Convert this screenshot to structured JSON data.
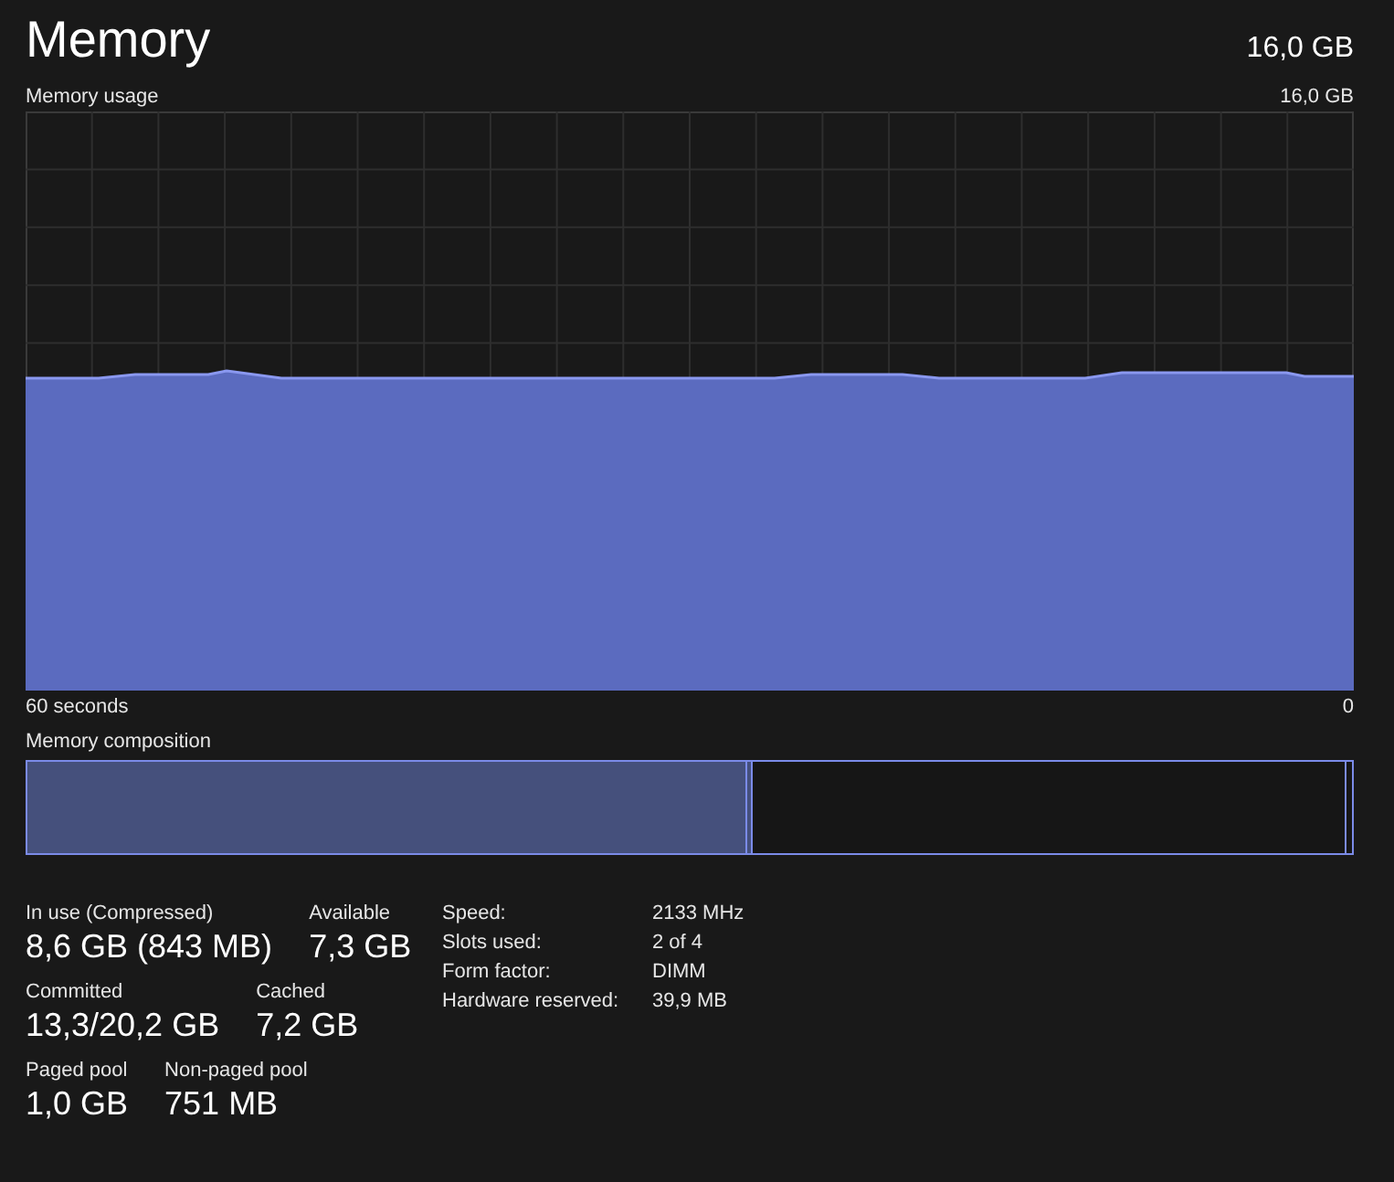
{
  "header": {
    "title": "Memory",
    "total": "16,0 GB"
  },
  "usage_graph": {
    "label": "Memory usage",
    "max_label": "16,0 GB",
    "left_label": "60 seconds",
    "right_label": "0"
  },
  "composition": {
    "label": "Memory composition",
    "level": 0.548
  },
  "stats": [
    [
      {
        "label": "In use (Compressed)",
        "value": "8,6 GB (843 MB)"
      },
      {
        "label": "Available",
        "value": "7,3 GB"
      }
    ],
    [
      {
        "label": "Committed",
        "value": "13,3/20,2 GB"
      },
      {
        "label": "Cached",
        "value": "7,2 GB"
      }
    ],
    [
      {
        "label": "Paged pool",
        "value": "1,0 GB"
      },
      {
        "label": "Non-paged pool",
        "value": "751 MB"
      }
    ]
  ],
  "details": [
    {
      "label": "Speed:",
      "value": "2133 MHz"
    },
    {
      "label": "Slots used:",
      "value": "2 of 4"
    },
    {
      "label": "Form factor:",
      "value": "DIMM"
    },
    {
      "label": "Hardware reserved:",
      "value": "39,9 MB"
    }
  ]
}
